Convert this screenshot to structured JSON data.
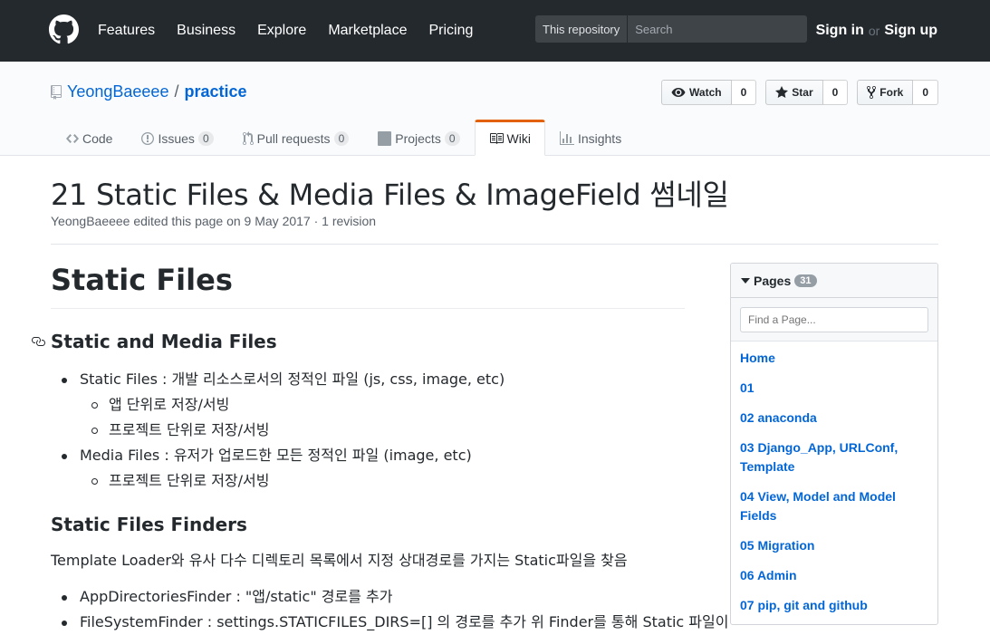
{
  "header": {
    "nav": [
      "Features",
      "Business",
      "Explore",
      "Marketplace",
      "Pricing"
    ],
    "search_scope": "This repository",
    "search_placeholder": "Search",
    "sign_in": "Sign in",
    "or": "or",
    "sign_up": "Sign up"
  },
  "repo": {
    "owner": "YeongBaeeee",
    "separator": "/",
    "name": "practice",
    "watch_label": "Watch",
    "watch_count": "0",
    "star_label": "Star",
    "star_count": "0",
    "fork_label": "Fork",
    "fork_count": "0"
  },
  "tabs": [
    {
      "label": "Code"
    },
    {
      "label": "Issues",
      "count": "0"
    },
    {
      "label": "Pull requests",
      "count": "0"
    },
    {
      "label": "Projects",
      "count": "0"
    },
    {
      "label": "Wiki"
    },
    {
      "label": "Insights"
    }
  ],
  "page": {
    "title": "21 Static Files & Media Files & ImageField 썸네일",
    "meta": "YeongBaeeee edited this page on 9 May 2017 · 1 revision"
  },
  "content": {
    "h1": "Static Files",
    "h2": "Static and Media Files",
    "list1_item1": "Static Files : 개발 리소스로서의 정적인 파일 (js, css, image, etc)",
    "list1_item1_sub1": "앱 단위로 저장/서빙",
    "list1_item1_sub2": "프로젝트 단위로 저장/서빙",
    "list1_item2": "Media Files : 유저가 업로드한 모든 정적인 파일 (image, etc)",
    "list1_item2_sub1": "프로젝트 단위로 저장/서빙",
    "h3": "Static Files Finders",
    "para": "Template Loader와 유사 다수 디렉토리 목록에서 지정 상대경로를 가지는 Static파일을 찾음",
    "list2_item1": "AppDirectoriesFinder : \"앱/static\" 경로를 추가",
    "list2_item2": "FileSystemFinder : settings.STATICFILES_DIRS=[] 의 경로를 추가 위 Finder를 통해 Static 파일이"
  },
  "sidebar": {
    "title": "Pages",
    "count": "31",
    "filter_placeholder": "Find a Page...",
    "pages": [
      "Home",
      "01",
      "02 anaconda",
      "03 Django_App, URLConf, Template",
      "04 View, Model and Model Fields",
      "05 Migration",
      "06 Admin",
      "07 pip, git and github"
    ]
  },
  "colors": {
    "header_bg": "#24292e",
    "link": "#0366d6",
    "tab_accent": "#e36209"
  }
}
